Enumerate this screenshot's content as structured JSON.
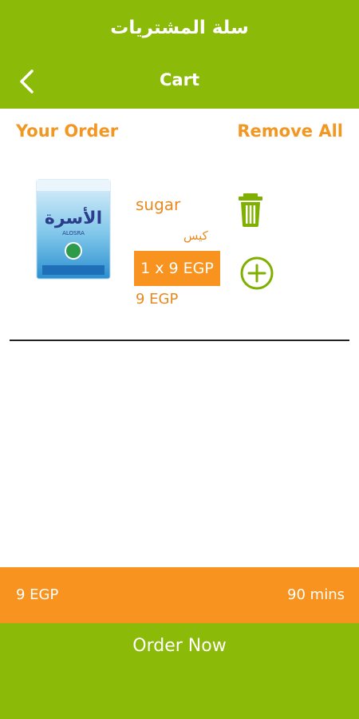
{
  "header": {
    "app_title": "سلة المشتريات",
    "screen_title": "Cart",
    "back_icon": "chevron-left-icon"
  },
  "order_section": {
    "title": "Your Order",
    "remove_all_label": "Remove All"
  },
  "items": [
    {
      "name": "sugar",
      "unit": "كيس",
      "quantity_price": "1 x 9 EGP",
      "total": "9 EGP",
      "image_brand_text": "الأسرة",
      "image_brand_latin": "ALOSRA",
      "delete_icon": "trash-icon",
      "add_icon": "plus-circle-icon"
    }
  ],
  "summary": {
    "total": "9 EGP",
    "delivery_time": "90 mins"
  },
  "order_button": {
    "label": "Order Now"
  },
  "colors": {
    "header_green": "#8cba08",
    "accent_orange": "#f7931e",
    "text_orange": "#e88a1e",
    "white": "#ffffff"
  }
}
